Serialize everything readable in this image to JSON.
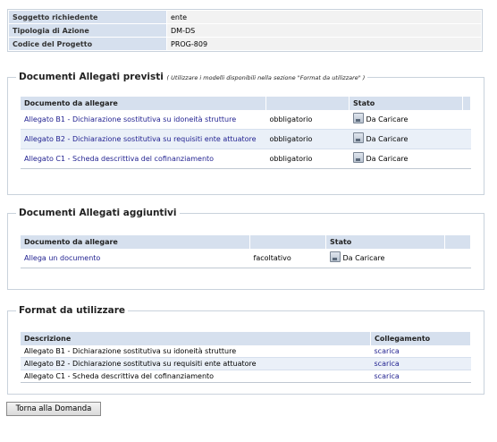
{
  "info": [
    {
      "label": "Soggetto richiedente",
      "value": "ente"
    },
    {
      "label": "Tipologia di Azione",
      "value": "DM-DS"
    },
    {
      "label": "Codice del Progetto",
      "value": "PROG-809"
    }
  ],
  "previsti": {
    "title": "Documenti Allegati previsti",
    "note": "( Utilizzare i modelli disponibili nella sezione \"Format da utilizzare\" )",
    "headers": {
      "documento": "Documento da allegare",
      "stato": "Stato"
    },
    "rows": [
      {
        "doc": "Allegato B1 - Dichiarazione sostitutiva su idoneità strutture",
        "tipo": "obbligatorio",
        "stato": "Da Caricare"
      },
      {
        "doc": "Allegato B2 - Dichiarazione sostitutiva su requisiti ente attuatore",
        "tipo": "obbligatorio",
        "stato": "Da Caricare"
      },
      {
        "doc": "Allegato C1 - Scheda descrittiva del cofinanziamento",
        "tipo": "obbligatorio",
        "stato": "Da Caricare"
      }
    ]
  },
  "aggiuntivi": {
    "title": "Documenti Allegati aggiuntivi",
    "headers": {
      "documento": "Documento da allegare",
      "stato": "Stato"
    },
    "rows": [
      {
        "doc": "Allega un documento",
        "tipo": "facoltativo",
        "stato": "Da Caricare"
      }
    ]
  },
  "format": {
    "title": "Format da utilizzare",
    "headers": {
      "descrizione": "Descrizione",
      "collegamento": "Collegamento"
    },
    "rows": [
      {
        "desc": "Allegato B1 - Dichiarazione sostitutiva su idoneità strutture",
        "link": "scarica"
      },
      {
        "desc": "Allegato B2 - Dichiarazione sostitutiva su requisiti ente attuatore",
        "link": "scarica"
      },
      {
        "desc": "Allegato C1 - Scheda descrittiva del cofinanziamento",
        "link": "scarica"
      }
    ]
  },
  "button": {
    "label": "Torna alla Domanda"
  },
  "icons": {
    "status": "upload-disk-icon"
  },
  "colors": {
    "header_bg": "#d6e0ee",
    "link": "#1f1f8f",
    "border": "#c9d2dc"
  }
}
